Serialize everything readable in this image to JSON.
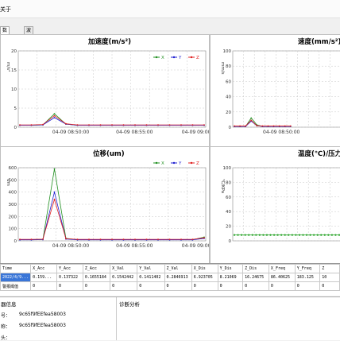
{
  "menu": {
    "item": "关于"
  },
  "tabs": [
    {
      "label": "数据监控",
      "active": true
    },
    {
      "label": "波形频谱",
      "active": false
    }
  ],
  "charts": [
    {
      "title": "加速度(m/s²)",
      "y_axis_label": "m/s²",
      "y_ticks": [
        "20",
        "15",
        "10",
        "5",
        "0"
      ],
      "x_ticks": [
        "04-09 08:50:00",
        "04-09 08:55:00",
        "04-09 09:00:00"
      ],
      "legend": [
        "X",
        "Y",
        "Z"
      ]
    },
    {
      "title": "速度(mm/s²)",
      "y_axis_label": "mm/s",
      "y_ticks": [
        "100",
        "80",
        "60",
        "40",
        "20",
        "0"
      ],
      "x_ticks": [
        "04-09 08:50:00"
      ],
      "legend": []
    },
    {
      "title": "位移(um)",
      "y_axis_label": "um",
      "y_ticks": [
        "600",
        "500",
        "400",
        "300",
        "200",
        "100",
        "0"
      ],
      "x_ticks": [
        "04-09 08:50:00",
        "04-09 08:55:00",
        "04-09 09:00:00"
      ],
      "legend": [
        "X",
        "Y",
        "Z"
      ]
    },
    {
      "title": "温度(℃)/压力(",
      "y_axis_label": "℃/KPa",
      "y_ticks": [
        "100",
        "80",
        "60",
        "40",
        "20",
        "0"
      ],
      "x_ticks": [],
      "legend": []
    }
  ],
  "table": {
    "headers": [
      "Time",
      "X_Acc",
      "Y_Acc",
      "Z_Acc",
      "X_Val",
      "Y_Val",
      "Z_Val",
      "X_Dis",
      "Y_Dis",
      "Z_Dis",
      "X_Freq",
      "Y_Freq",
      "Z"
    ],
    "rows": [
      [
        "2022/4/9...",
        "0.159...",
        "0.137322",
        "0.1655184",
        "0.1542442",
        "0.1411402",
        "0.2846913",
        "6.923705",
        "8.21069",
        "16.24675",
        "86.40625",
        "183.125",
        "10"
      ],
      [
        "警报阈值",
        "0",
        "0",
        "0",
        "0",
        "0",
        "0",
        "0",
        "0",
        "0",
        "0",
        "0",
        "0"
      ]
    ]
  },
  "info": {
    "sensor_section": "器信息",
    "diag_section": "诊断分析",
    "rows": [
      {
        "label": "号：",
        "value": "9c65f9fEEfea58003"
      },
      {
        "label": "称：",
        "value": "9c65f9fEEfea58003"
      },
      {
        "label": "头：",
        "value": ""
      }
    ]
  },
  "colors": {
    "x": "#1f8f1f",
    "y": "#1f1fd0",
    "z": "#e01f1f",
    "temp": "#1fa01f"
  },
  "chart_data": [
    {
      "type": "line",
      "title": "加速度(m/s²)",
      "ylabel": "m/s²",
      "ylim": [
        0,
        20
      ],
      "x": [
        "08:45",
        "08:46",
        "08:47",
        "08:48",
        "08:49",
        "08:50",
        "08:51",
        "08:52",
        "08:53",
        "08:54",
        "08:55",
        "08:56",
        "08:57",
        "08:58",
        "08:59",
        "09:00",
        "09:01"
      ],
      "series": [
        {
          "name": "X",
          "values": [
            0.5,
            0.5,
            0.6,
            3.5,
            0.8,
            0.5,
            0.5,
            0.5,
            0.5,
            0.5,
            0.5,
            0.5,
            0.5,
            0.5,
            0.5,
            0.5,
            0.5
          ]
        },
        {
          "name": "Y",
          "values": [
            0.5,
            0.5,
            0.6,
            2.5,
            0.8,
            0.5,
            0.5,
            0.5,
            0.5,
            0.5,
            0.5,
            0.5,
            0.5,
            0.5,
            0.5,
            0.5,
            0.5
          ]
        },
        {
          "name": "Z",
          "values": [
            0.6,
            0.6,
            0.7,
            3.0,
            0.9,
            0.6,
            0.6,
            0.6,
            0.6,
            0.6,
            0.6,
            0.6,
            0.6,
            0.6,
            0.6,
            0.6,
            0.6
          ]
        }
      ]
    },
    {
      "type": "line",
      "title": "速度(mm/s²)",
      "ylabel": "mm/s",
      "ylim": [
        0,
        100
      ],
      "x": [
        "08:45",
        "08:46",
        "08:47",
        "08:48",
        "08:49",
        "08:50",
        "08:51",
        "08:52",
        "08:53",
        "08:54",
        "08:55"
      ],
      "series": [
        {
          "name": "X",
          "values": [
            1,
            1,
            1,
            12,
            3,
            1,
            1,
            1,
            1,
            1,
            1
          ]
        },
        {
          "name": "Y",
          "values": [
            1,
            1,
            1,
            8,
            2,
            1,
            1,
            1,
            1,
            1,
            1
          ]
        },
        {
          "name": "Z",
          "values": [
            1.5,
            1.5,
            1.5,
            9,
            2,
            1.5,
            1.5,
            1.5,
            1.5,
            1.5,
            1.5
          ]
        }
      ]
    },
    {
      "type": "line",
      "title": "位移(um)",
      "ylabel": "um",
      "ylim": [
        0,
        600
      ],
      "x": [
        "08:45",
        "08:46",
        "08:47",
        "08:48",
        "08:49",
        "08:50",
        "08:51",
        "08:52",
        "08:53",
        "08:54",
        "08:55",
        "08:56",
        "08:57",
        "08:58",
        "08:59",
        "09:00",
        "09:01"
      ],
      "series": [
        {
          "name": "X",
          "values": [
            10,
            10,
            12,
            590,
            20,
            10,
            10,
            10,
            10,
            10,
            10,
            10,
            10,
            10,
            10,
            10,
            30
          ]
        },
        {
          "name": "Y",
          "values": [
            8,
            8,
            10,
            400,
            15,
            8,
            8,
            8,
            8,
            8,
            8,
            8,
            8,
            8,
            8,
            8,
            20
          ]
        },
        {
          "name": "Z",
          "values": [
            12,
            12,
            14,
            340,
            18,
            12,
            12,
            12,
            12,
            12,
            12,
            12,
            12,
            12,
            12,
            12,
            25
          ]
        }
      ]
    },
    {
      "type": "line",
      "title": "温度(℃)/压力(",
      "ylabel": "℃/KPa",
      "ylim": [
        0,
        100
      ],
      "series": [
        {
          "name": "",
          "values": [
            8,
            8,
            8,
            8,
            8,
            8,
            8,
            8,
            8,
            8,
            8,
            8,
            8,
            8,
            8,
            8,
            8,
            8,
            8,
            8,
            8,
            8,
            8,
            8,
            8,
            8,
            8,
            8,
            8,
            8
          ]
        }
      ]
    }
  ]
}
